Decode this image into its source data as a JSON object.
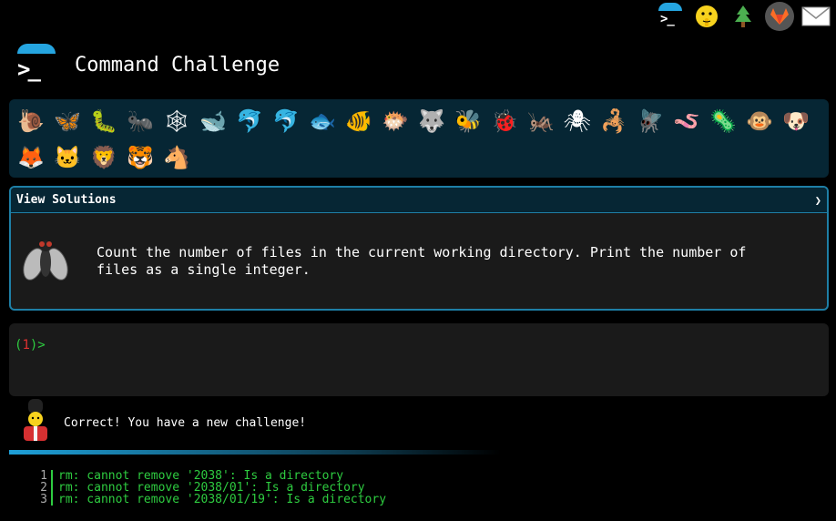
{
  "app": {
    "title": "Command Challenge"
  },
  "topbar": {
    "icons": [
      "terminal-icon",
      "shushing-face-icon",
      "tree-icon",
      "gitlab-fox-icon",
      "envelope-icon"
    ]
  },
  "animals": [
    "snail",
    "butterfly",
    "caterpillar",
    "ant",
    "spider-web",
    "whale",
    "dolphin",
    "dolphin-grey",
    "fish",
    "tropical-fish",
    "pufferfish",
    "wolf",
    "bee",
    "ladybug",
    "cricket",
    "spider",
    "scorpion",
    "fly",
    "worm",
    "microbe",
    "monkey",
    "dog",
    "fox",
    "cat",
    "lion",
    "tiger",
    "horse"
  ],
  "solutions": {
    "header_label": "View Solutions",
    "chevron": "❯",
    "challenge_text": "Count the number of files in the current working directory. Print the number of files as a single integer."
  },
  "terminal": {
    "prompt_open": "(",
    "prompt_num": "1",
    "prompt_close": ")>"
  },
  "feedback": {
    "message": "Correct! You have a new challenge!"
  },
  "progress": {
    "fraction": 0.6
  },
  "output": {
    "lines": [
      {
        "num": "1",
        "text": "rm: cannot remove '2038': Is a directory"
      },
      {
        "num": "2",
        "text": "rm: cannot remove '2038/01': Is a directory"
      },
      {
        "num": "3",
        "text": "rm: cannot remove '2038/01/19': Is a directory"
      }
    ]
  },
  "colors": {
    "accent": "#25a5e0",
    "panel": "#062634",
    "output_green": "#2ecc40",
    "prompt_red": "#e03131"
  }
}
